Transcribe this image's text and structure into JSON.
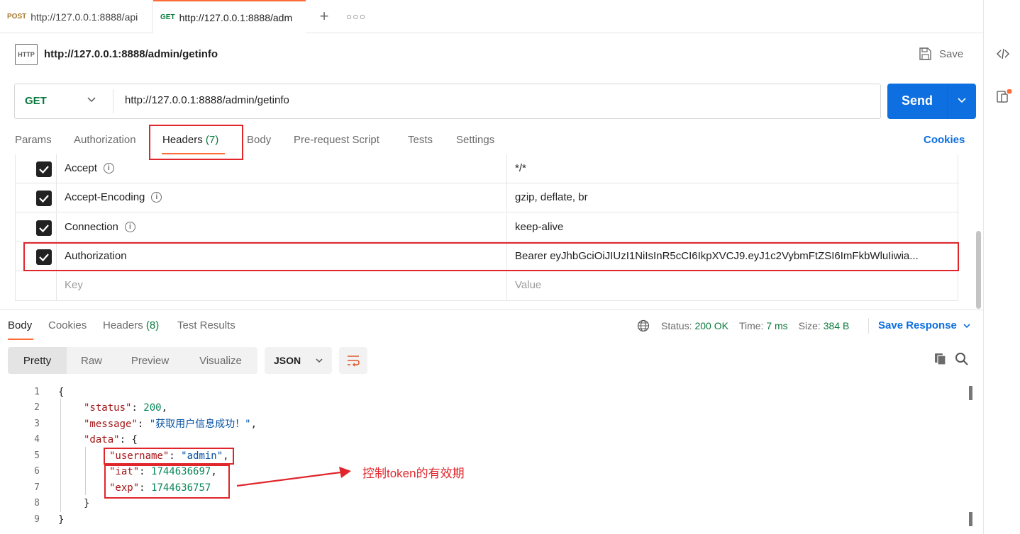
{
  "tabs": [
    {
      "method": "POST",
      "label": "http://127.0.0.1:8888/api"
    },
    {
      "method": "GET",
      "label": "http://127.0.0.1:8888/adm"
    }
  ],
  "request": {
    "title": "http://127.0.0.1:8888/admin/getinfo",
    "http_icon": "HTTP",
    "save_label": "Save",
    "method": "GET",
    "url": "http://127.0.0.1:8888/admin/getinfo",
    "send_label": "Send"
  },
  "request_tabs": {
    "params": "Params",
    "authorization": "Authorization",
    "headers": "Headers",
    "headers_count": "(7)",
    "body": "Body",
    "prerequest": "Pre-request Script",
    "tests": "Tests",
    "settings": "Settings",
    "cookies": "Cookies"
  },
  "headers": [
    {
      "key": "Accept",
      "value": "*/*"
    },
    {
      "key": "Accept-Encoding",
      "value": "gzip, deflate, br"
    },
    {
      "key": "Connection",
      "value": "keep-alive"
    },
    {
      "key": "Authorization",
      "value": "Bearer eyJhbGciOiJIUzI1NiIsInR5cCI6IkpXVCJ9.eyJ1c2VybmFtZSI6ImFkbWluIiwia..."
    }
  ],
  "headers_placeholder": {
    "key": "Key",
    "value": "Value"
  },
  "response_tabs": {
    "body": "Body",
    "cookies": "Cookies",
    "headers": "Headers",
    "headers_count": "(8)",
    "test_results": "Test Results"
  },
  "response_status": {
    "status_label": "Status:",
    "status_value": "200 OK",
    "time_label": "Time:",
    "time_value": "7 ms",
    "size_label": "Size:",
    "size_value": "384 B",
    "save_response": "Save Response"
  },
  "view_modes": [
    "Pretty",
    "Raw",
    "Preview",
    "Visualize"
  ],
  "format": "JSON",
  "line_numbers": [
    "1",
    "2",
    "3",
    "4",
    "5",
    "6",
    "7",
    "8",
    "9"
  ],
  "code": {
    "open": "{",
    "status_key": "\"status\"",
    "status_val": "200",
    "message_key": "\"message\"",
    "message_val": "\"获取用户信息成功！\"",
    "data_key": "\"data\"",
    "data_open": "{",
    "username_key": "\"username\"",
    "username_val": "\"admin\"",
    "iat_key": "\"iat\"",
    "iat_val": "1744636697",
    "exp_key": "\"exp\"",
    "exp_val": "1744636757",
    "data_close": "}",
    "close": "}"
  },
  "annotation": "控制token的有效期",
  "colors": {
    "accent": "#ff6c37",
    "send": "#0d6fe0",
    "get": "#0a7a3d",
    "annotation": "#e0262b"
  }
}
